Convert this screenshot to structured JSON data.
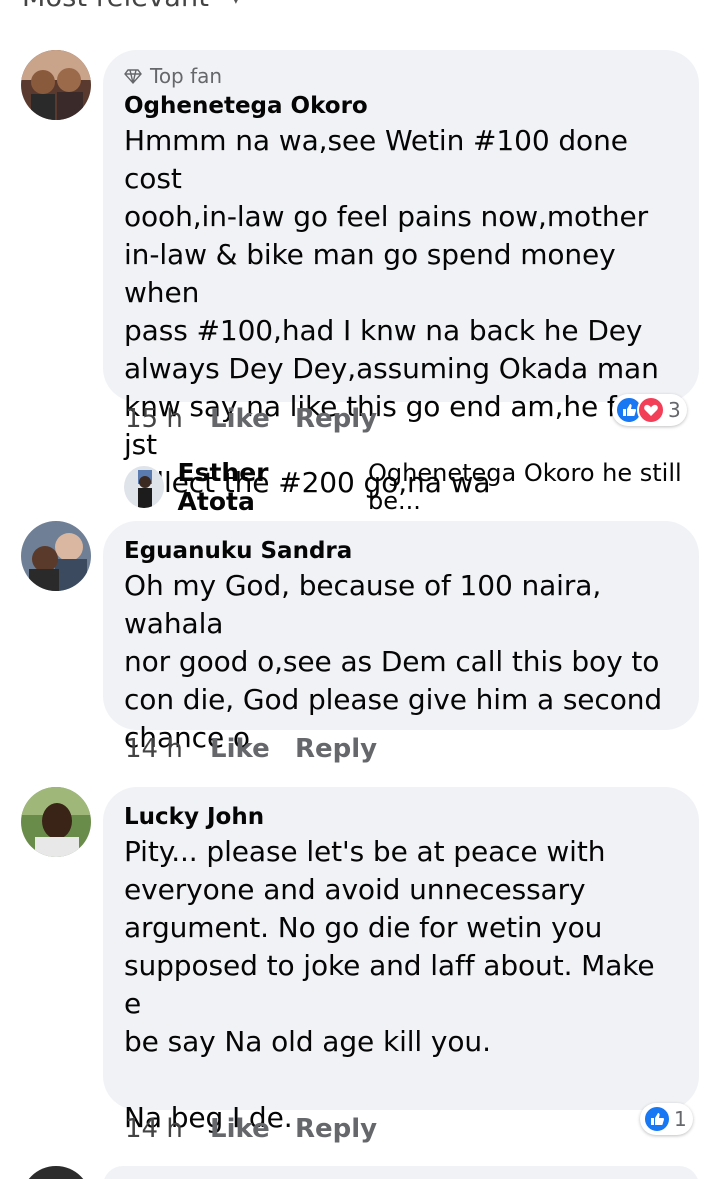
{
  "header": {
    "sort_label": "Most relevant"
  },
  "comments": [
    {
      "badge": "Top fan",
      "author": "Oghenetega Okoro",
      "text": "Hmmm na wa,see Wetin #100 done cost\noooh,in-law go feel pains now,mother\nin-law & bike man go spend money when\npass #100,had I knw na back he Dey\nalways Dey Dey,assuming Okada man\nknw say na like this go end am,he for jst\ncollect the #200 go,na wa",
      "time": "15 h",
      "like": "Like",
      "reply": "Reply",
      "reactions": [
        "like",
        "love"
      ],
      "reaction_count": "3"
    },
    {
      "author": "Eguanuku Sandra",
      "text": "Oh my God, because of 100 naira, wahala\nnor good o,see as Dem call this boy to\ncon die, God please give him a second\nchance o",
      "time": "14 h",
      "like": "Like",
      "reply": "Reply"
    },
    {
      "author": "Lucky John",
      "text": "Pity... please let's be at peace with\neveryone and avoid unnecessary\nargument. No go die for wetin you\nsupposed to joke and laff about. Make e\nbe say Na old age kill you.\n\nNa beg I de.",
      "time": "14 h",
      "like": "Like",
      "reply": "Reply",
      "reactions": [
        "like"
      ],
      "reaction_count": "1"
    }
  ],
  "reply_preview": {
    "author": "Esther Atota",
    "snippet": "Oghenetega Okoro he still be..."
  },
  "colors": {
    "bubble": "#f0f2f5",
    "like_blue": "#1877f2",
    "love_red": "#f33e58",
    "meta_gray": "#65676b"
  }
}
